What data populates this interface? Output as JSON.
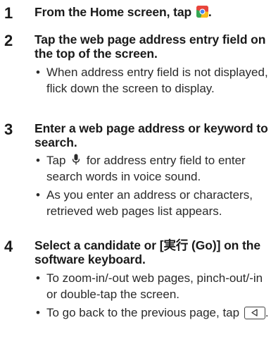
{
  "steps": [
    {
      "number": "1",
      "title_before_icon": "From the Home screen, tap ",
      "title_icon": "chrome-icon",
      "title_after_icon": ".",
      "bullets": []
    },
    {
      "number": "2",
      "title": "Tap the web page address entry field on the top of the screen.",
      "bullets": [
        "When address entry field is not displayed, flick down the screen to display."
      ]
    },
    {
      "number": "3",
      "title": "Enter a web page address or keyword to search.",
      "bullets": [
        {
          "before_icon": "Tap ",
          "icon": "microphone-icon",
          "after_icon": " for address entry field to enter search words in voice sound."
        },
        "As you enter an address or characters, retrieved web pages list appears."
      ]
    },
    {
      "number": "4",
      "title": "Select a candidate or [実行 (Go)] on the software keyboard.",
      "bullets": [
        "To zoom-in/-out web pages, pinch-out/-in or double-tap the screen.",
        {
          "before_icon": "To go back to the previous page, tap ",
          "icon": "back-key-icon",
          "after_icon": "."
        }
      ]
    }
  ]
}
